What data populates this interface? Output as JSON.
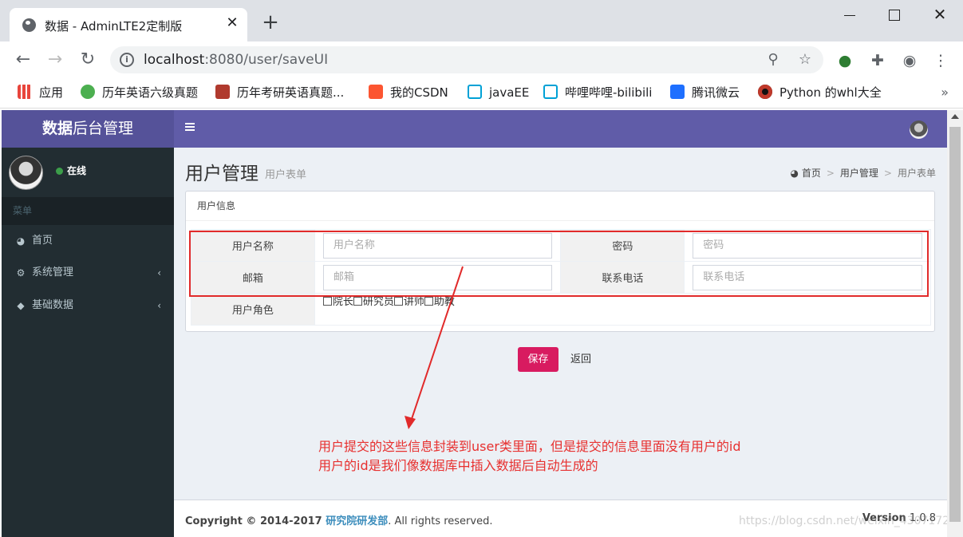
{
  "browser": {
    "tab_title": "数据 - AdminLTE2定制版",
    "url_host": "localhost",
    "url_rest": ":8080/user/saveUI",
    "bookmarks": [
      {
        "label": "应用",
        "color": "#e8453c"
      },
      {
        "label": "历年英语六级真题",
        "color": "#4caf50"
      },
      {
        "label": "历年考研英语真题...",
        "color": "#b03a2e"
      },
      {
        "label": "我的CSDN",
        "color": "#fc5531"
      },
      {
        "label": "javaEE",
        "color": "#00a1d6"
      },
      {
        "label": "哔哩哔哩-bilibili",
        "color": "#00a1d6"
      },
      {
        "label": "腾讯微云",
        "color": "#1e6fff"
      },
      {
        "label": "Python 的whl大全",
        "color": "#c0392b"
      }
    ]
  },
  "app": {
    "logo_bold": "数据",
    "logo_rest": "后台管理",
    "user_status": "在线",
    "menu_header": "菜单",
    "menu": [
      {
        "label": "首页",
        "icon": "dashboard-icon"
      },
      {
        "label": "系统管理",
        "icon": "cogs-icon"
      },
      {
        "label": "基础数据",
        "icon": "cube-icon"
      }
    ]
  },
  "content": {
    "title": "用户管理",
    "subtitle": "用户表单",
    "breadcrumb": [
      "首页",
      "用户管理",
      "用户表单"
    ],
    "box_title": "用户信息",
    "fields": {
      "username_label": "用户名称",
      "username_placeholder": "用户名称",
      "password_label": "密码",
      "password_placeholder": "密码",
      "email_label": "邮箱",
      "email_placeholder": "邮箱",
      "phone_label": "联系电话",
      "phone_placeholder": "联系电话",
      "role_label": "用户角色",
      "roles": [
        "院长",
        "研究员",
        "讲师",
        "助教"
      ]
    },
    "save_label": "保存",
    "back_label": "返回"
  },
  "annotation": {
    "line1": "用户提交的这些信息封装到user类里面，但是提交的信息里面没有用户的id",
    "line2": "用户的id是我们像数据库中插入数据后自动生成的"
  },
  "footer": {
    "copyright_prefix": "Copyright © 2014-2017 ",
    "org": "研究院研发部",
    "copyright_suffix": ". All rights reserved.",
    "version_label": "Version",
    "version": " 1.0.8"
  },
  "watermark": "https://blog.csdn.net/weixin_43071721"
}
